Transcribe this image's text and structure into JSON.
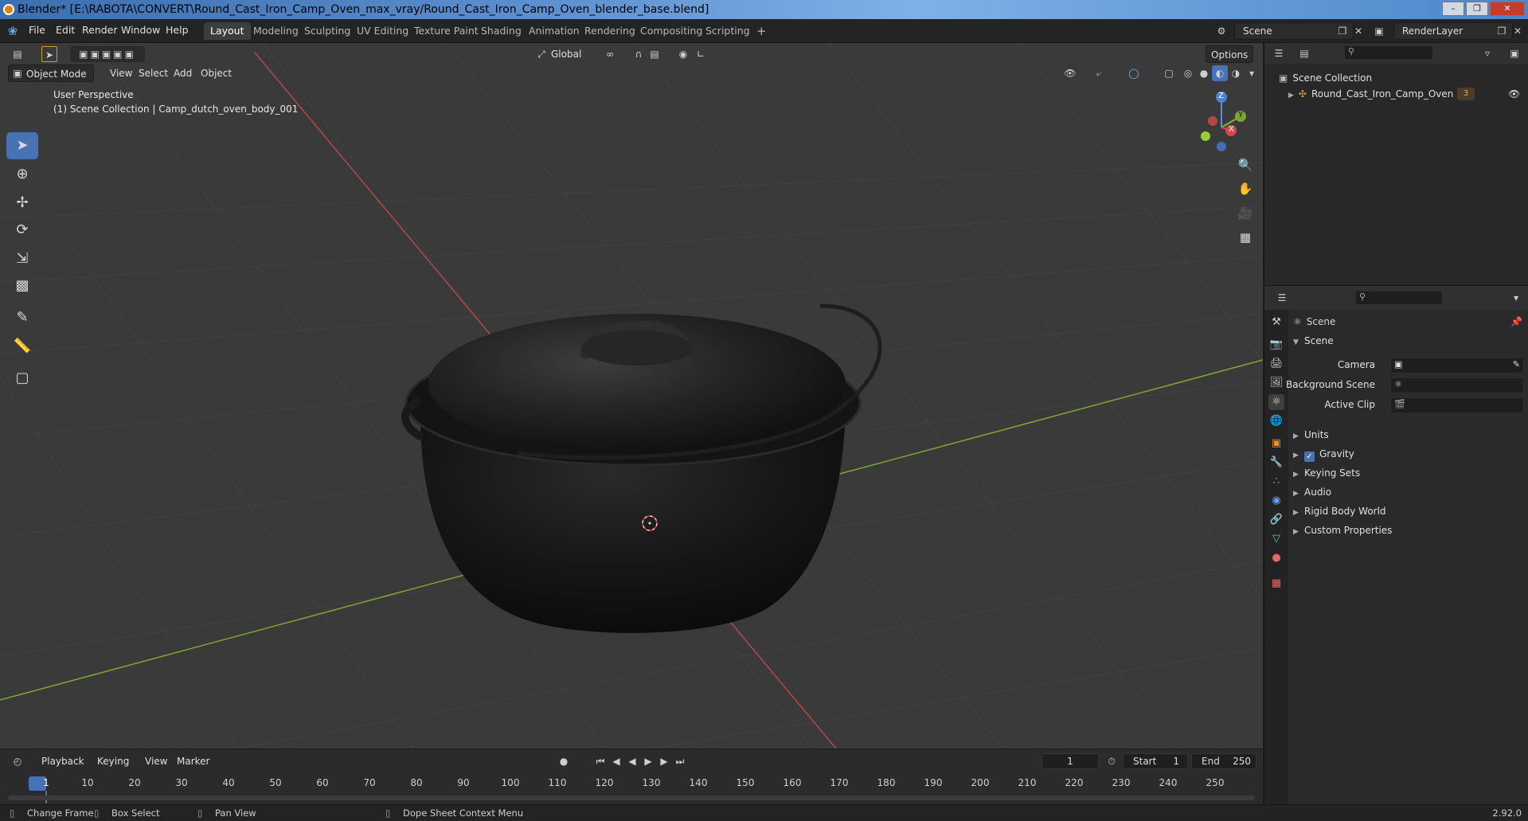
{
  "window": {
    "title": "Blender* [E:\\RABOTA\\CONVERT\\Round_Cast_Iron_Camp_Oven_max_vray/Round_Cast_Iron_Camp_Oven_blender_base.blend]"
  },
  "menu": {
    "items": [
      "File",
      "Edit",
      "Render",
      "Window",
      "Help"
    ]
  },
  "workspaces": {
    "tabs": [
      "Layout",
      "Modeling",
      "Sculpting",
      "UV Editing",
      "Texture Paint",
      "Shading",
      "Animation",
      "Rendering",
      "Compositing",
      "Scripting"
    ],
    "active": "Layout",
    "add_label": "+"
  },
  "scene_selector": {
    "value": "Scene"
  },
  "view_layer_selector": {
    "value": "RenderLayer"
  },
  "viewport_header": {
    "mode": "Object Mode",
    "menus": [
      "View",
      "Select",
      "Add",
      "Object"
    ],
    "orientation": "Global",
    "options_label": "Options"
  },
  "viewport": {
    "perspective_label": "User Perspective",
    "collection_label": "(1) Scene Collection | Camp_dutch_oven_body_001",
    "gizmo": {
      "z": "Z",
      "y": "Y",
      "x": "X"
    }
  },
  "outliner": {
    "root": "Scene Collection",
    "items": [
      {
        "label": "Round_Cast_Iron_Camp_Oven",
        "badge": "3"
      }
    ]
  },
  "properties": {
    "context": "Scene",
    "section": "Scene",
    "fields": [
      {
        "label": "Camera",
        "value": ""
      },
      {
        "label": "Background Scene",
        "value": ""
      },
      {
        "label": "Active Clip",
        "value": ""
      }
    ],
    "panels": [
      {
        "label": "Units",
        "checkbox": false
      },
      {
        "label": "Gravity",
        "checkbox": true,
        "checked": true
      },
      {
        "label": "Keying Sets",
        "checkbox": false
      },
      {
        "label": "Audio",
        "checkbox": false
      },
      {
        "label": "Rigid Body World",
        "checkbox": false
      },
      {
        "label": "Custom Properties",
        "checkbox": false
      }
    ]
  },
  "timeline": {
    "menus": [
      "Playback",
      "Keying",
      "View",
      "Marker"
    ],
    "current_frame": "1",
    "start_label": "Start",
    "start": "1",
    "end_label": "End",
    "end": "250",
    "ruler": [
      "1",
      "10",
      "20",
      "30",
      "40",
      "50",
      "60",
      "70",
      "80",
      "90",
      "100",
      "110",
      "120",
      "130",
      "140",
      "150",
      "160",
      "170",
      "180",
      "190",
      "200",
      "210",
      "220",
      "230",
      "240",
      "250"
    ]
  },
  "statusbar": {
    "items": [
      "Change Frame",
      "Box Select",
      "Pan View",
      "Dope Sheet Context Menu"
    ],
    "version": "2.92.0"
  },
  "colors": {
    "accent": "#4772b3",
    "viewport_bg": "#3a3a3a",
    "x_axis": "#c94a4a",
    "y_axis": "#8cb43a"
  }
}
